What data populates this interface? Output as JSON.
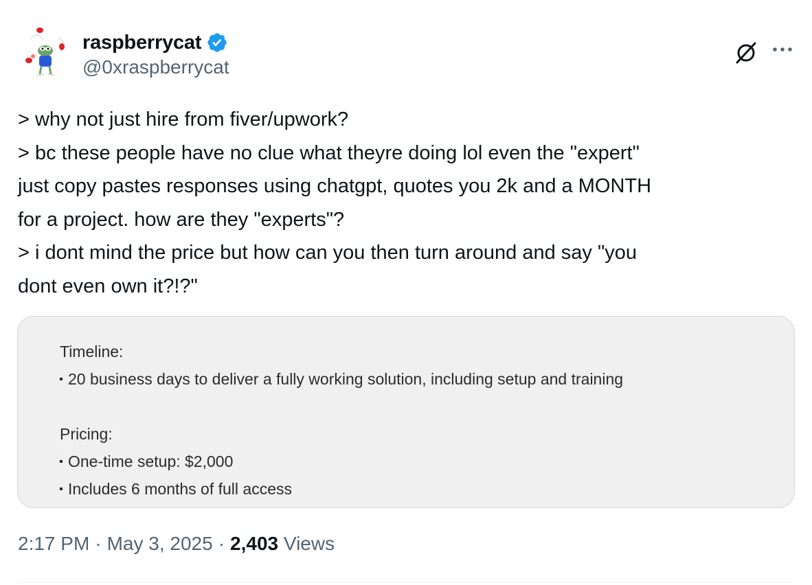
{
  "author": {
    "display_name": "raspberrycat",
    "handle": "@0xraspberrycat",
    "verified": true,
    "verified_color": "#1d9bf0",
    "avatar_icon": "pepe-frog-avatar"
  },
  "actions": {
    "grok_icon": "grok-icon",
    "more_icon": "more-horizontal-icon"
  },
  "tweet": {
    "lines": [
      "> why not just hire from fiver/upwork?",
      "> bc these people have no clue what theyre doing lol even the \"expert\"",
      "just copy pastes responses using chatgpt, quotes you 2k and a MONTH",
      "for a project. how are they \"experts\"?",
      "> i dont mind the price but how can you then turn around and say \"you",
      "dont even own it?!?\""
    ]
  },
  "attached_image": {
    "timeline_heading": "Timeline:",
    "timeline_items": [
      "20 business days to deliver a fully working solution, including setup and training"
    ],
    "pricing_heading": "Pricing:",
    "pricing_items": [
      "One-time setup: $2,000",
      "Includes 6 months of full access"
    ]
  },
  "meta": {
    "time": "2:17 PM",
    "date": "May 3, 2025",
    "separator": "·",
    "views_count": "2,403",
    "views_label": "Views"
  }
}
